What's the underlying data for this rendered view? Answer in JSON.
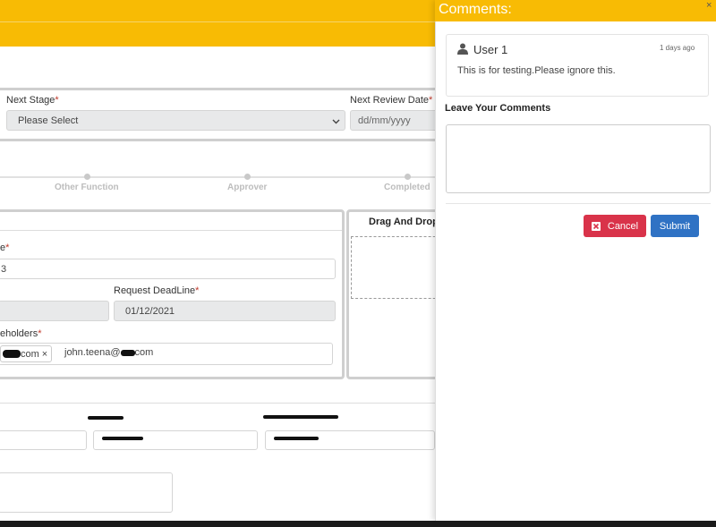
{
  "stage_section": {
    "next_stage_label": "Next Stage",
    "next_stage_value": "Please Select",
    "next_review_date_label": "Next Review Date",
    "next_review_date_placeholder": "dd/mm/yyyy",
    "required_mark": "*"
  },
  "workflow": {
    "steps": [
      "Other Function",
      "Approver",
      "Completed"
    ]
  },
  "request_form": {
    "field_label_partial": "e",
    "field_value_partial": "3",
    "request_deadline_label": "Request DeadLine",
    "request_deadline_value": "01/12/2021",
    "stakeholders_label_partial": "eholders",
    "stakeholder_chip_text": "com",
    "stakeholder_input_value": "john.teena@",
    "stakeholder_input_value_suffix": "com",
    "chip_remove": "×"
  },
  "drag_drop": {
    "title": "Drag And Drop"
  },
  "comments_drawer": {
    "title": "Comments:",
    "close": "×",
    "comment": {
      "user": "User 1",
      "time": "1 days ago",
      "text": "This is for testing.Please ignore this."
    },
    "leave_label": "Leave Your Comments",
    "cancel_label": "Cancel",
    "submit_label": "Submit"
  },
  "colors": {
    "brand_yellow": "#f8bb04",
    "cancel_red": "#d9334a",
    "submit_blue": "#2f72c4"
  }
}
